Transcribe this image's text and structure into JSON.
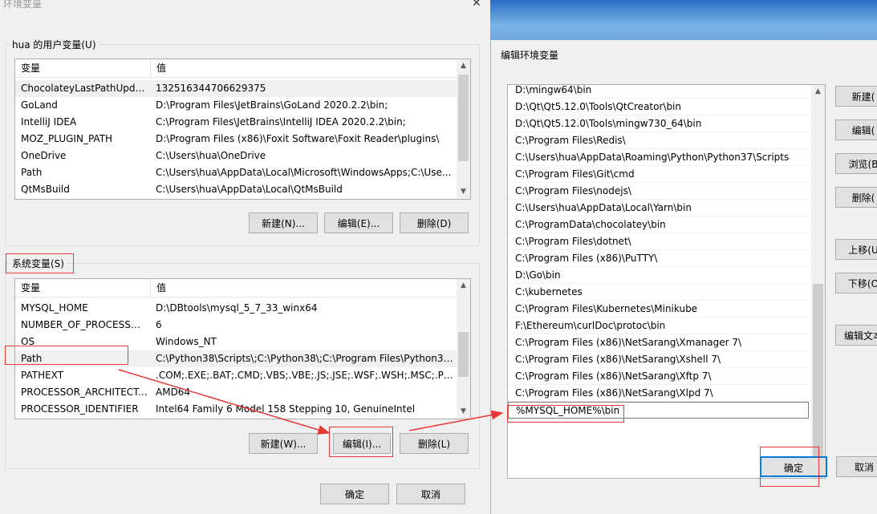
{
  "env_dialog": {
    "title": "环境变量",
    "close_glyph": "✕",
    "user_group_label": "hua 的用户变量(U)",
    "system_group_label": "系统变量(S)",
    "columns": [
      "变量",
      "值"
    ],
    "user_vars": [
      {
        "name": "ChocolateyLastPathUpdate",
        "value": "132516344706629375"
      },
      {
        "name": "GoLand",
        "value": "D:\\Program Files\\JetBrains\\GoLand 2020.2.2\\bin;"
      },
      {
        "name": "IntelliJ IDEA",
        "value": "C:\\Program Files\\JetBrains\\IntelliJ IDEA 2020.2.2\\bin;"
      },
      {
        "name": "MOZ_PLUGIN_PATH",
        "value": "D:\\Program Files (x86)\\Foxit Software\\Foxit Reader\\plugins\\"
      },
      {
        "name": "OneDrive",
        "value": "C:\\Users\\hua\\OneDrive"
      },
      {
        "name": "Path",
        "value": "C:\\Users\\hua\\AppData\\Local\\Microsoft\\WindowsApps;C:\\Use..."
      },
      {
        "name": "QtMsBuild",
        "value": "C:\\Users\\hua\\AppData\\Local\\QtMsBuild"
      }
    ],
    "system_vars": [
      {
        "name": "MYSQL_HOME",
        "value": "D:\\DBtools\\mysql_5_7_33_winx64"
      },
      {
        "name": "NUMBER_OF_PROCESSORS",
        "value": "6"
      },
      {
        "name": "OS",
        "value": "Windows_NT"
      },
      {
        "name": "Path",
        "value": "C:\\Python38\\Scripts\\;C:\\Python38\\;C:\\Program Files\\Python37\\..."
      },
      {
        "name": "PATHEXT",
        "value": ".COM;.EXE;.BAT;.CMD;.VBS;.VBE;.JS;.JSE;.WSF;.WSH;.MSC;.PY;.P..."
      },
      {
        "name": "PROCESSOR_ARCHITECT...",
        "value": "AMD64"
      },
      {
        "name": "PROCESSOR_IDENTIFIER",
        "value": "Intel64 Family 6 Model 158 Stepping 10, GenuineIntel"
      }
    ],
    "user_buttons": {
      "new": "新建(N)...",
      "edit": "编辑(E)...",
      "delete": "删除(D)"
    },
    "system_buttons": {
      "new": "新建(W)...",
      "edit": "编辑(I)...",
      "delete": "删除(L)"
    },
    "ok": "确定",
    "cancel": "取消"
  },
  "edit_dialog": {
    "title": "编辑环境变量",
    "paths": [
      "D:\\mingw64\\bin",
      "D:\\Qt\\Qt5.12.0\\Tools\\QtCreator\\bin",
      "D:\\Qt\\Qt5.12.0\\Tools\\mingw730_64\\bin",
      "C:\\Program Files\\Redis\\",
      "C:\\Users\\hua\\AppData\\Roaming\\Python\\Python37\\Scripts",
      "C:\\Program Files\\Git\\cmd",
      "C:\\Program Files\\nodejs\\",
      "C:\\Users\\hua\\AppData\\Local\\Yarn\\bin",
      "C:\\ProgramData\\chocolatey\\bin",
      "C:\\Program Files\\dotnet\\",
      "C:\\Program Files (x86)\\PuTTY\\",
      "D:\\Go\\bin",
      "C:\\kubernetes",
      "C:\\Program Files\\Kubernetes\\Minikube",
      "F:\\Ethereum\\curlDoc\\protoc\\bin",
      "C:\\Program Files (x86)\\NetSarang\\Xmanager 7\\",
      "C:\\Program Files (x86)\\NetSarang\\Xshell 7\\",
      "C:\\Program Files (x86)\\NetSarang\\Xftp 7\\",
      "C:\\Program Files (x86)\\NetSarang\\Xlpd 7\\",
      "%MYSQL_HOME%\\bin"
    ],
    "side_buttons": {
      "new": "新建(",
      "edit": "编辑(",
      "browse": "浏览(B",
      "delete": "删除(",
      "move_up": "上移(U",
      "move_down": "下移(O",
      "edit_text": "编辑文本"
    },
    "ok": "确定",
    "cancel": "取消"
  },
  "annotation_color": "#e53935"
}
